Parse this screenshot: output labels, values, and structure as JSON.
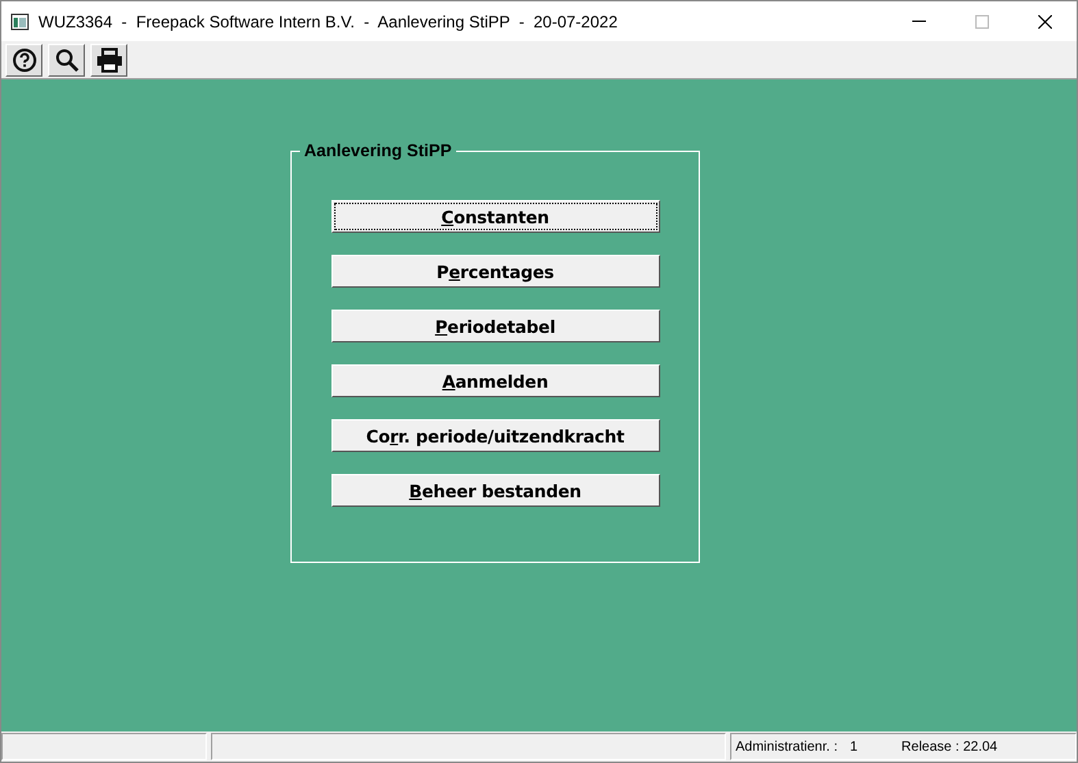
{
  "window": {
    "title": "WUZ3364  -  Freepack Software Intern B.V.  -  Aanlevering StiPP  -  20-07-2022"
  },
  "toolbar": [
    {
      "kind": "help"
    },
    {
      "kind": "search"
    },
    {
      "kind": "print"
    }
  ],
  "group": {
    "title": "Aanlevering StiPP",
    "buttons": [
      {
        "underlined": "C",
        "rest": "onstanten",
        "focused": true
      },
      {
        "start": "P",
        "underlined": "e",
        "rest": "rcentages",
        "focused": false
      },
      {
        "underlined": "P",
        "rest": "eriodetabel",
        "focused": false
      },
      {
        "underlined": "A",
        "rest": "anmelden",
        "focused": false
      },
      {
        "start": "Co",
        "underlined": "r",
        "rest": "r. periode/uitzendkracht",
        "focused": false
      },
      {
        "underlined": "B",
        "rest": "eheer bestanden",
        "focused": false
      }
    ]
  },
  "status_bar": {
    "admin_label": "Administratienr. :",
    "admin_value": "1",
    "release": "Release : 22.04"
  }
}
